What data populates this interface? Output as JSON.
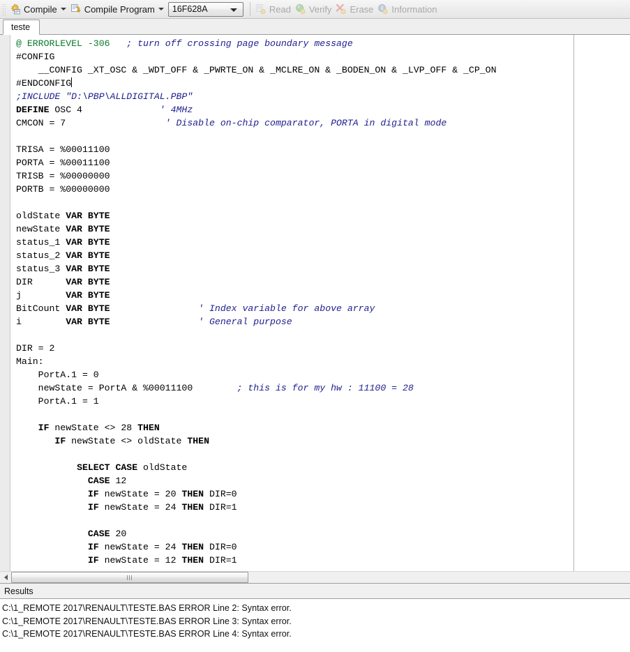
{
  "toolbar": {
    "items": [
      {
        "label": "Compile",
        "icon": "compile-gear-icon",
        "caret": true,
        "disabled": false
      },
      {
        "label": "Compile Program",
        "icon": "compile-program-icon",
        "caret": true,
        "disabled": false
      }
    ],
    "device_combo": {
      "value": "16F628A",
      "name": "device-select"
    },
    "actions": [
      {
        "label": "Read",
        "icon": "read-icon",
        "disabled": true
      },
      {
        "label": "Verify",
        "icon": "verify-icon",
        "disabled": true
      },
      {
        "label": "Erase",
        "icon": "erase-icon",
        "disabled": true
      },
      {
        "label": "Information",
        "icon": "information-icon",
        "disabled": true
      }
    ]
  },
  "tabs": [
    {
      "label": "teste",
      "active": true
    }
  ],
  "editor": {
    "margin_guide_column": 807,
    "caret_line": 3,
    "lines": [
      [
        {
          "t": "@ ERRORLEVEL -306",
          "c": "gr"
        },
        {
          "t": "   "
        },
        {
          "t": "; turn off crossing page boundary message",
          "c": "cm"
        }
      ],
      [
        {
          "t": "#CONFIG"
        }
      ],
      [
        {
          "t": "    __CONFIG _XT_OSC & _WDT_OFF & _PWRTE_ON & _MCLRE_ON & _BODEN_ON & _LVP_OFF & _CP_ON"
        }
      ],
      [
        {
          "t": "#ENDCONFIG"
        },
        {
          "t": "",
          "c": "caret"
        }
      ],
      [
        {
          "t": ";INCLUDE \"D:\\PBP\\ALLDIGITAL.PBP\"",
          "c": "cm"
        }
      ],
      [
        {
          "t": "DEFINE",
          "c": "k"
        },
        {
          "t": " OSC 4              "
        },
        {
          "t": "' 4MHz",
          "c": "cm"
        }
      ],
      [
        {
          "t": "CMCON = 7                  "
        },
        {
          "t": "' Disable on-chip comparator, PORTA in digital mode",
          "c": "cm"
        }
      ],
      [
        {
          "t": ""
        }
      ],
      [
        {
          "t": "TRISA = %00011100"
        }
      ],
      [
        {
          "t": "PORTA = %00011100"
        }
      ],
      [
        {
          "t": "TRISB = %00000000"
        }
      ],
      [
        {
          "t": "PORTB = %00000000"
        }
      ],
      [
        {
          "t": ""
        }
      ],
      [
        {
          "t": "oldState "
        },
        {
          "t": "VAR BYTE",
          "c": "k"
        }
      ],
      [
        {
          "t": "newState "
        },
        {
          "t": "VAR BYTE",
          "c": "k"
        }
      ],
      [
        {
          "t": "status_1 "
        },
        {
          "t": "VAR BYTE",
          "c": "k"
        }
      ],
      [
        {
          "t": "status_2 "
        },
        {
          "t": "VAR BYTE",
          "c": "k"
        }
      ],
      [
        {
          "t": "status_3 "
        },
        {
          "t": "VAR BYTE",
          "c": "k"
        }
      ],
      [
        {
          "t": "DIR      "
        },
        {
          "t": "VAR BYTE",
          "c": "k"
        }
      ],
      [
        {
          "t": "j        "
        },
        {
          "t": "VAR BYTE",
          "c": "k"
        }
      ],
      [
        {
          "t": "BitCount "
        },
        {
          "t": "VAR BYTE",
          "c": "k"
        },
        {
          "t": "                "
        },
        {
          "t": "' Index variable for above array",
          "c": "cm"
        }
      ],
      [
        {
          "t": "i        "
        },
        {
          "t": "VAR BYTE",
          "c": "k"
        },
        {
          "t": "                "
        },
        {
          "t": "' General purpose",
          "c": "cm"
        }
      ],
      [
        {
          "t": ""
        }
      ],
      [
        {
          "t": "DIR = 2"
        }
      ],
      [
        {
          "t": "Main:"
        }
      ],
      [
        {
          "t": "    PortA.1 = 0"
        }
      ],
      [
        {
          "t": "    newState = PortA & %00011100        "
        },
        {
          "t": "; this is for my hw : 11100 = 28",
          "c": "cm"
        }
      ],
      [
        {
          "t": "    PortA.1 = 1"
        }
      ],
      [
        {
          "t": ""
        }
      ],
      [
        {
          "t": "    "
        },
        {
          "t": "IF",
          "c": "k"
        },
        {
          "t": " newState <> 28 "
        },
        {
          "t": "THEN",
          "c": "k"
        }
      ],
      [
        {
          "t": "       "
        },
        {
          "t": "IF",
          "c": "k"
        },
        {
          "t": " newState <> oldState "
        },
        {
          "t": "THEN",
          "c": "k"
        }
      ],
      [
        {
          "t": ""
        }
      ],
      [
        {
          "t": "           "
        },
        {
          "t": "SELECT CASE",
          "c": "k"
        },
        {
          "t": " oldState"
        }
      ],
      [
        {
          "t": "             "
        },
        {
          "t": "CASE",
          "c": "k"
        },
        {
          "t": " 12"
        }
      ],
      [
        {
          "t": "             "
        },
        {
          "t": "IF",
          "c": "k"
        },
        {
          "t": " newState = 20 "
        },
        {
          "t": "THEN",
          "c": "k"
        },
        {
          "t": " DIR=0"
        }
      ],
      [
        {
          "t": "             "
        },
        {
          "t": "IF",
          "c": "k"
        },
        {
          "t": " newState = 24 "
        },
        {
          "t": "THEN",
          "c": "k"
        },
        {
          "t": " DIR=1"
        }
      ],
      [
        {
          "t": ""
        }
      ],
      [
        {
          "t": "             "
        },
        {
          "t": "CASE",
          "c": "k"
        },
        {
          "t": " 20"
        }
      ],
      [
        {
          "t": "             "
        },
        {
          "t": "IF",
          "c": "k"
        },
        {
          "t": " newState = 24 "
        },
        {
          "t": "THEN",
          "c": "k"
        },
        {
          "t": " DIR=0"
        }
      ],
      [
        {
          "t": "             "
        },
        {
          "t": "IF",
          "c": "k"
        },
        {
          "t": " newState = 12 "
        },
        {
          "t": "THEN",
          "c": "k"
        },
        {
          "t": " DIR=1"
        }
      ]
    ]
  },
  "hscroll": {
    "thumb_width": 340,
    "thumb_left": 0
  },
  "results": {
    "header": "Results",
    "lines": [
      "C:\\1_REMOTE 2017\\RENAULT\\TESTE.BAS ERROR Line 2: Syntax error.",
      "C:\\1_REMOTE 2017\\RENAULT\\TESTE.BAS ERROR Line 3: Syntax error.",
      "C:\\1_REMOTE 2017\\RENAULT\\TESTE.BAS ERROR Line 4: Syntax error."
    ]
  },
  "colors": {
    "keyword": "#000000",
    "comment": "#1d1d8f",
    "directive": "#0a7a2a",
    "editor_bg": "#ffffff",
    "chrome_bg": "#f0f0f0"
  }
}
